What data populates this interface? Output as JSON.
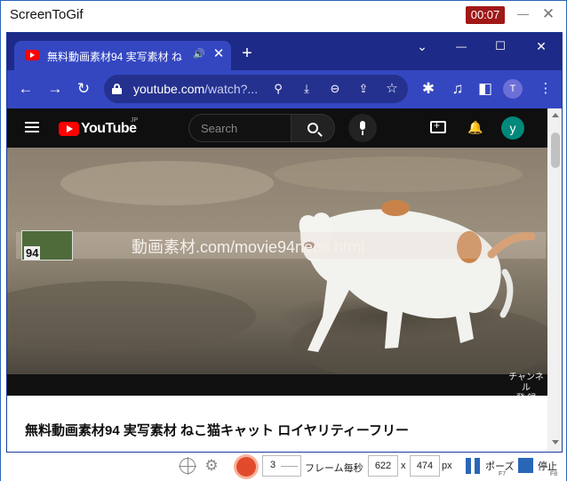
{
  "app": {
    "title": "ScreenToGif",
    "timer": "00:07",
    "close_glyph": "✕"
  },
  "browser": {
    "tab": {
      "title": "無料動画素材94 実写素材 ね",
      "audio_glyph": "🔊",
      "close_glyph": "✕"
    },
    "new_tab_glyph": "+",
    "window_controls": {
      "dropdown": "⌄",
      "minimize": "—",
      "maximize": "☐",
      "close": "✕"
    },
    "nav": {
      "back": "←",
      "forward": "→",
      "reload": "↻"
    },
    "url": {
      "host": "youtube.com",
      "path": "/watch?..."
    },
    "omnibox_icons": {
      "search": "⚲",
      "install": "⤓",
      "zoom": "⊖",
      "share": "⇪",
      "bookmark": "☆"
    },
    "toolbar_icons": {
      "extensions": "✱",
      "media": "♫",
      "sidepanel": "◧"
    },
    "profile_initial": "T"
  },
  "youtube": {
    "logo_text": "YouTube",
    "logo_region": "JP",
    "search_placeholder": "Search",
    "bell_glyph": "🔔",
    "avatar_initial": "y",
    "overlay_number": "94",
    "overlay_text": "動画素材.com/movie94neco.html",
    "channel_mark_line1": "チャンネル",
    "channel_mark_line2": "登 録",
    "video_title": "無料動画素材94 実写素材 ねこ猫キャット ロイヤリティーフリー"
  },
  "recorder": {
    "fps_value": "3",
    "fps_label": "フレーム毎秒",
    "width": "622",
    "size_separator": "x",
    "height": "474",
    "unit": "px",
    "pause_label": "ポーズ",
    "pause_key": "F7",
    "stop_label": "停止",
    "stop_key": "F8",
    "gear_glyph": "⚙"
  },
  "colors": {
    "accent": "#2a66b8",
    "timer_bg": "#a01818",
    "chrome_frame": "#1e2a87",
    "chrome_toolbar": "#3447c1",
    "record": "#e24a2c"
  }
}
